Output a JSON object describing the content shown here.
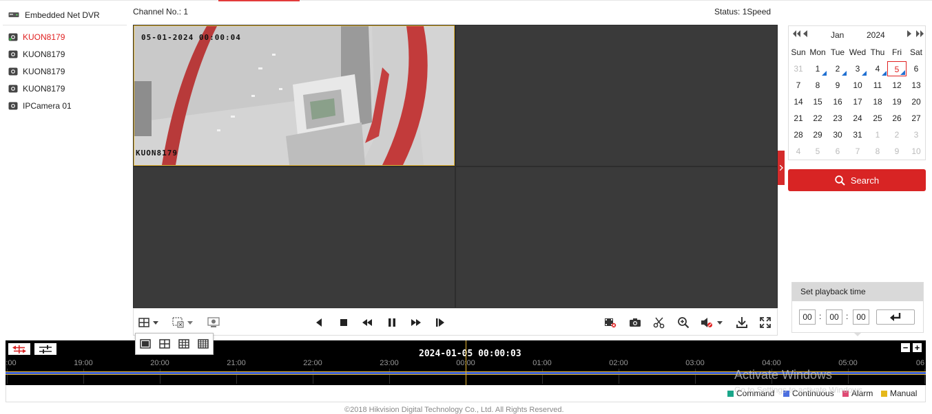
{
  "sidebar": {
    "title": "Embedded Net DVR",
    "cameras": [
      {
        "label": "KUON8179",
        "active": true
      },
      {
        "label": "KUON8179",
        "active": false
      },
      {
        "label": "KUON8179",
        "active": false
      },
      {
        "label": "KUON8179",
        "active": false
      },
      {
        "label": "IPCamera 01",
        "active": false
      }
    ]
  },
  "header": {
    "channel": "Channel No.: 1",
    "status": "Status: 1Speed"
  },
  "video": {
    "osd_timestamp": "05-01-2024 00:00:04",
    "osd_camera_name": "KUON8179"
  },
  "calendar": {
    "month": "Jan",
    "year": "2024",
    "weekdays": [
      "Sun",
      "Mon",
      "Tue",
      "Wed",
      "Thu",
      "Fri",
      "Sat"
    ],
    "weeks": [
      [
        "31",
        "1",
        "2",
        "3",
        "4",
        "5",
        "6"
      ],
      [
        "7",
        "8",
        "9",
        "10",
        "11",
        "12",
        "13"
      ],
      [
        "14",
        "15",
        "16",
        "17",
        "18",
        "19",
        "20"
      ],
      [
        "21",
        "22",
        "23",
        "24",
        "25",
        "26",
        "27"
      ],
      [
        "28",
        "29",
        "30",
        "31",
        "1",
        "2",
        "3"
      ],
      [
        "4",
        "5",
        "6",
        "7",
        "8",
        "9",
        "10"
      ]
    ],
    "selected_day": "5",
    "days_with_recordings": [
      "1",
      "2",
      "3",
      "4",
      "5"
    ]
  },
  "search": {
    "label": "Search"
  },
  "playback_time": {
    "title": "Set playback time",
    "hour": "00",
    "minute": "00",
    "second": "00",
    "separator": ":"
  },
  "timeline": {
    "current_datetime": "2024-01-05 00:00:03",
    "ticks": [
      ":00",
      "19:00",
      "20:00",
      "21:00",
      "22:00",
      "23:00",
      "00:00",
      "01:00",
      "02:00",
      "03:00",
      "04:00",
      "05:00",
      "06"
    ],
    "zoom_out": "−",
    "zoom_in": "+"
  },
  "legend": [
    {
      "label": "Command",
      "color": "#1aa68a"
    },
    {
      "label": "Continuous",
      "color": "#4c6fe0"
    },
    {
      "label": "Alarm",
      "color": "#e04a74"
    },
    {
      "label": "Manual",
      "color": "#e5b81a"
    }
  ],
  "watermark": {
    "line1": "Activate Windows",
    "line2": "Go to Settings to activate Windows."
  },
  "footer": "©2018 Hikvision Digital Technology Co., Ltd. All Rights Reserved.",
  "colors": {
    "accent": "#d82424",
    "selection_border": "#e7b831",
    "record_bar": "#3b5fd6"
  }
}
